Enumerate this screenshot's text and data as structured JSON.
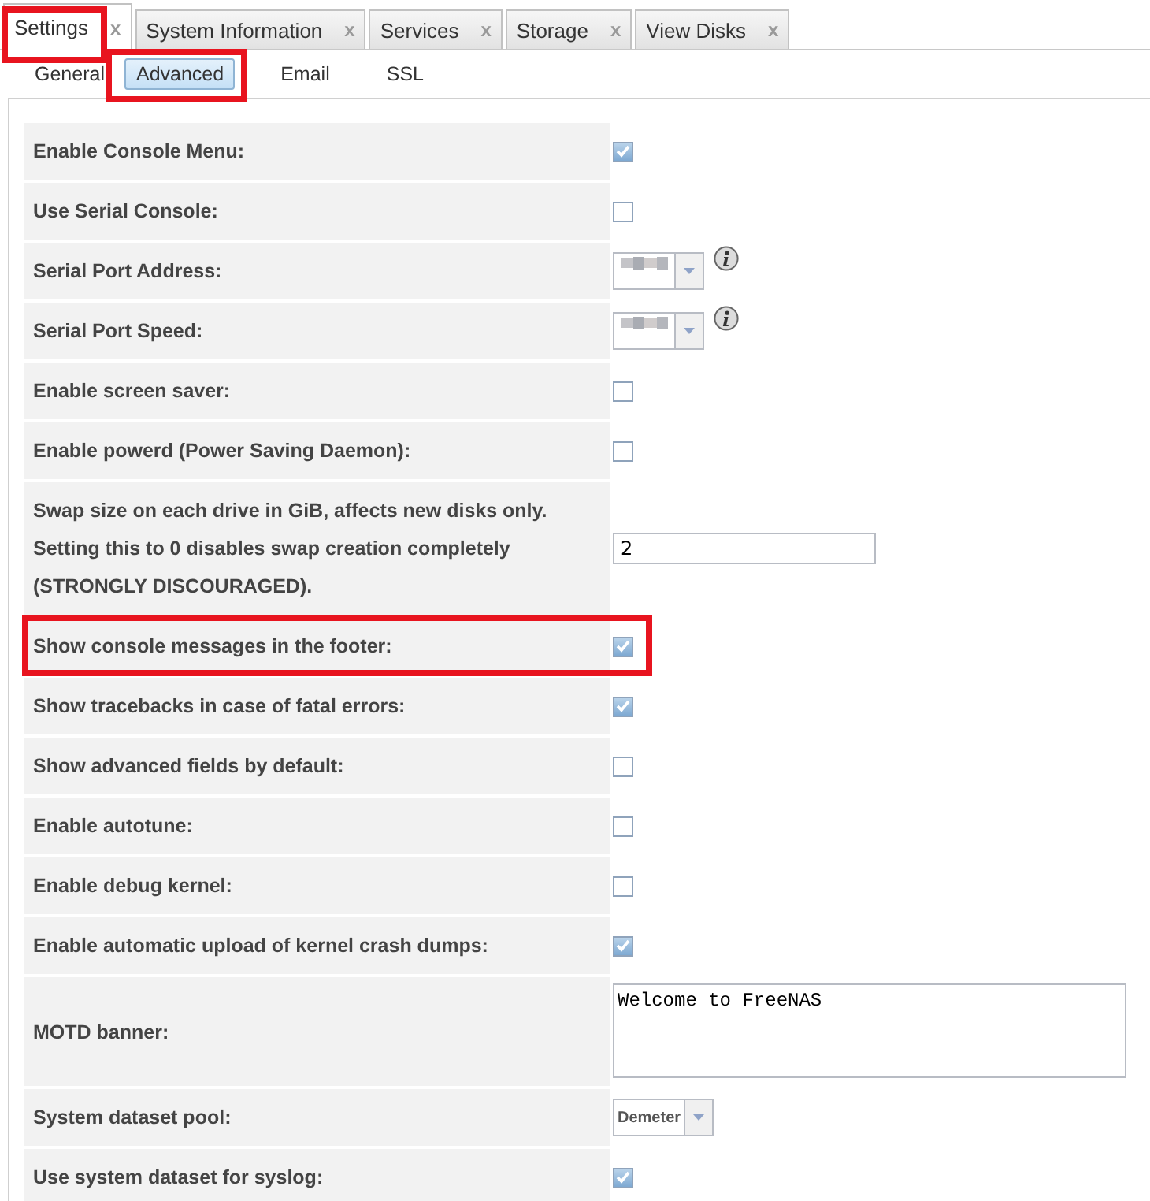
{
  "tabs": [
    {
      "label": "Settings",
      "close": "x",
      "selected": true,
      "highlighted": true
    },
    {
      "label": "System Information",
      "close": "x",
      "selected": false,
      "highlighted": false
    },
    {
      "label": "Services",
      "close": "x",
      "selected": false,
      "highlighted": false
    },
    {
      "label": "Storage",
      "close": "x",
      "selected": false,
      "highlighted": false
    },
    {
      "label": "View Disks",
      "close": "x",
      "selected": false,
      "highlighted": false
    }
  ],
  "subtabs": [
    {
      "label": "General",
      "selected": false,
      "highlighted": false
    },
    {
      "label": "Advanced",
      "selected": true,
      "highlighted": true
    },
    {
      "label": "Email",
      "selected": false,
      "highlighted": false
    },
    {
      "label": "SSL",
      "selected": false,
      "highlighted": false
    }
  ],
  "rows": [
    {
      "label": "Enable Console Menu:",
      "kind": "checkbox",
      "checked": true,
      "highlighted": false
    },
    {
      "label": "Use Serial Console:",
      "kind": "checkbox",
      "checked": false,
      "highlighted": false
    },
    {
      "label": "Serial Port Address:",
      "kind": "select",
      "info": true,
      "highlighted": false
    },
    {
      "label": "Serial Port Speed:",
      "kind": "select",
      "info": true,
      "highlighted": false
    },
    {
      "label": "Enable screen saver:",
      "kind": "checkbox",
      "checked": false,
      "highlighted": false
    },
    {
      "label": "Enable powerd (Power Saving Daemon):",
      "kind": "checkbox",
      "checked": false,
      "highlighted": false
    },
    {
      "label": "Swap size on each drive in GiB, affects new disks only. Setting this to 0 disables swap creation completely (STRONGLY DISCOURAGED).",
      "kind": "input",
      "value": "2",
      "highlighted": false
    },
    {
      "label": "Show console messages in the footer:",
      "kind": "checkbox",
      "checked": true,
      "highlighted": true
    },
    {
      "label": "Show tracebacks in case of fatal errors:",
      "kind": "checkbox",
      "checked": true,
      "highlighted": false
    },
    {
      "label": "Show advanced fields by default:",
      "kind": "checkbox",
      "checked": false,
      "highlighted": false
    },
    {
      "label": "Enable autotune:",
      "kind": "checkbox",
      "checked": false,
      "highlighted": false
    },
    {
      "label": "Enable debug kernel:",
      "kind": "checkbox",
      "checked": false,
      "highlighted": false
    },
    {
      "label": "Enable automatic upload of kernel crash dumps:",
      "kind": "checkbox",
      "checked": true,
      "highlighted": false
    },
    {
      "label": "MOTD banner:",
      "kind": "textarea",
      "value": "Welcome to FreeNAS",
      "highlighted": false
    },
    {
      "label": "System dataset pool:",
      "kind": "select",
      "value": "Demeter",
      "highlighted": false
    },
    {
      "label": "Use system dataset for syslog:",
      "kind": "checkbox",
      "checked": true,
      "highlighted": false
    }
  ]
}
